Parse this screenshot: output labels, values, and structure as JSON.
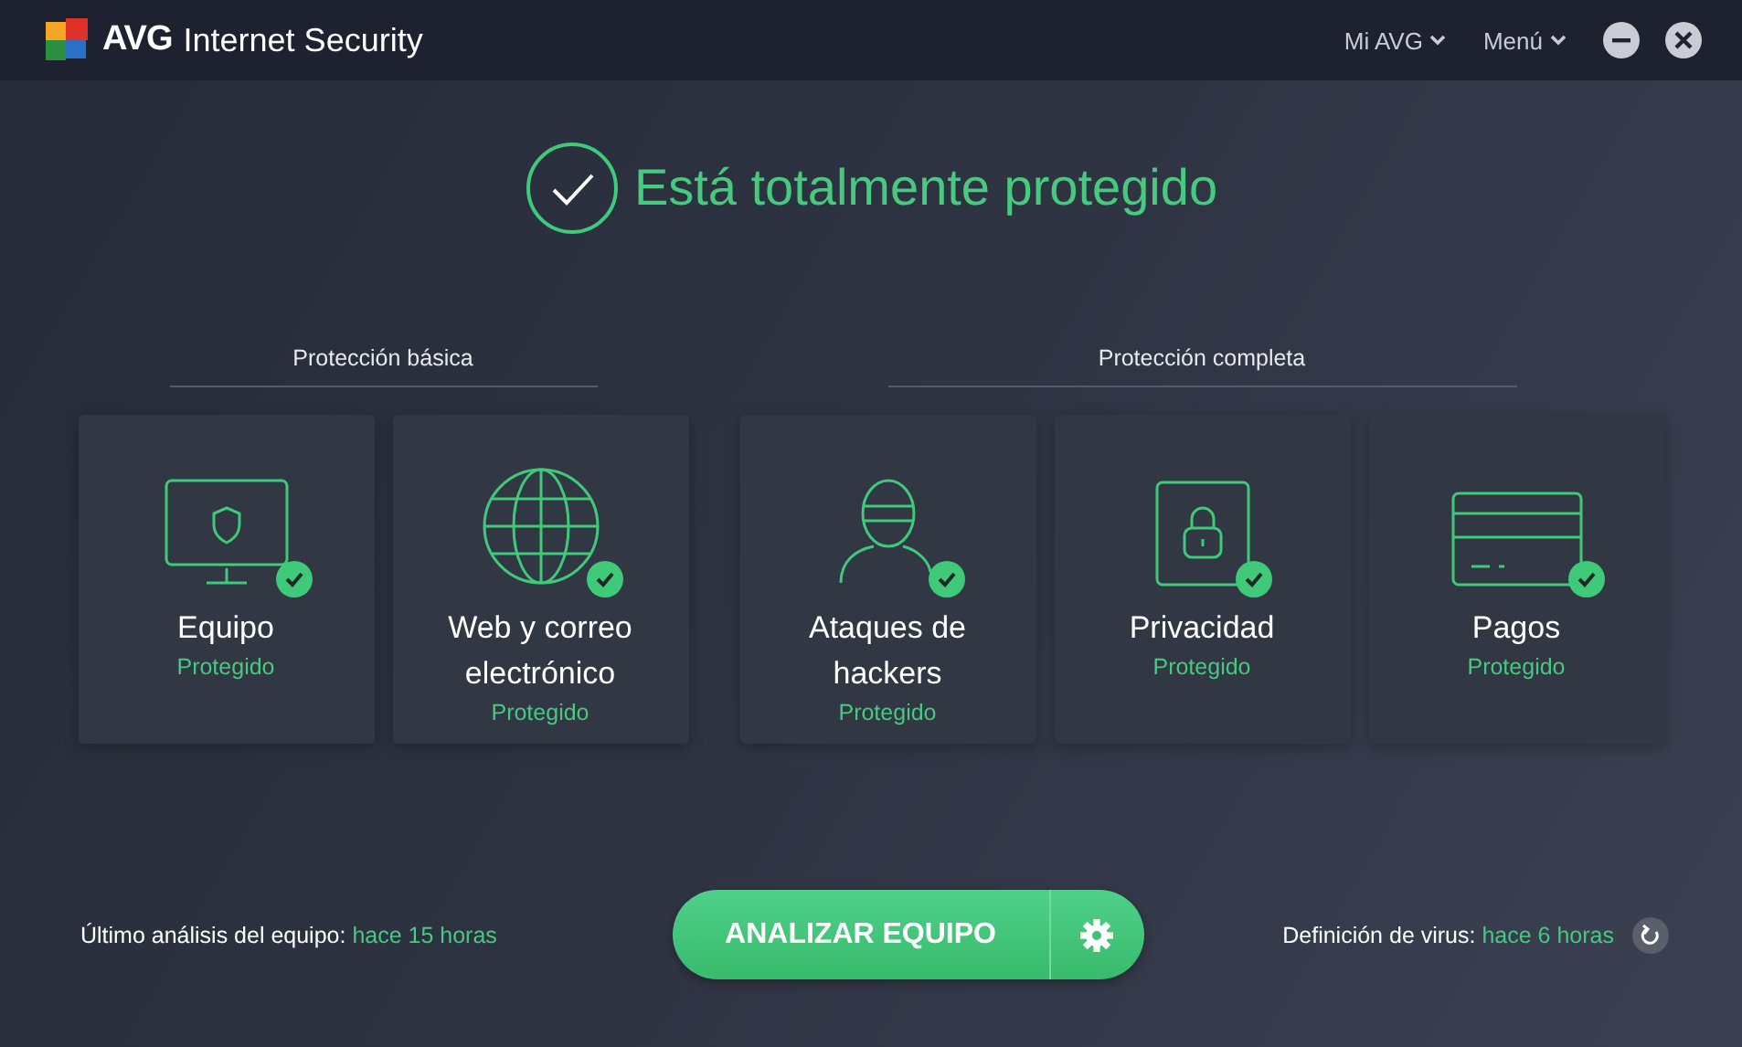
{
  "window": {
    "logo_text": "AVG",
    "title": "Internet Security"
  },
  "header_menu": [
    {
      "label": "Mi AVG"
    },
    {
      "label": "Menú"
    }
  ],
  "status": {
    "protected": true,
    "message": "Está totalmente protegido"
  },
  "groups": [
    {
      "title": "Protección básica",
      "cards": [
        {
          "kind": "monitor",
          "name": "Equipo",
          "status": "Protegido",
          "protected": true
        },
        {
          "kind": "globe",
          "name": "Web y correo electrónico",
          "status": "Protegido",
          "protected": true
        }
      ]
    },
    {
      "title": "Protección completa",
      "cards": [
        {
          "kind": "hacker",
          "name": "Ataques de hackers",
          "status": "Protegido",
          "protected": true
        },
        {
          "kind": "lock",
          "name": "Privacidad",
          "status": "Protegido",
          "protected": true
        },
        {
          "kind": "card",
          "name": "Pagos",
          "status": "Protegido",
          "protected": true
        }
      ]
    }
  ],
  "footer": {
    "last_scan_label": "Último análisis del equipo:",
    "last_scan_value": "hace 15 horas",
    "scan_button": "ANALIZAR EQUIPO",
    "virus_label": "Definición de virus:",
    "virus_value": "hace 6 horas"
  }
}
